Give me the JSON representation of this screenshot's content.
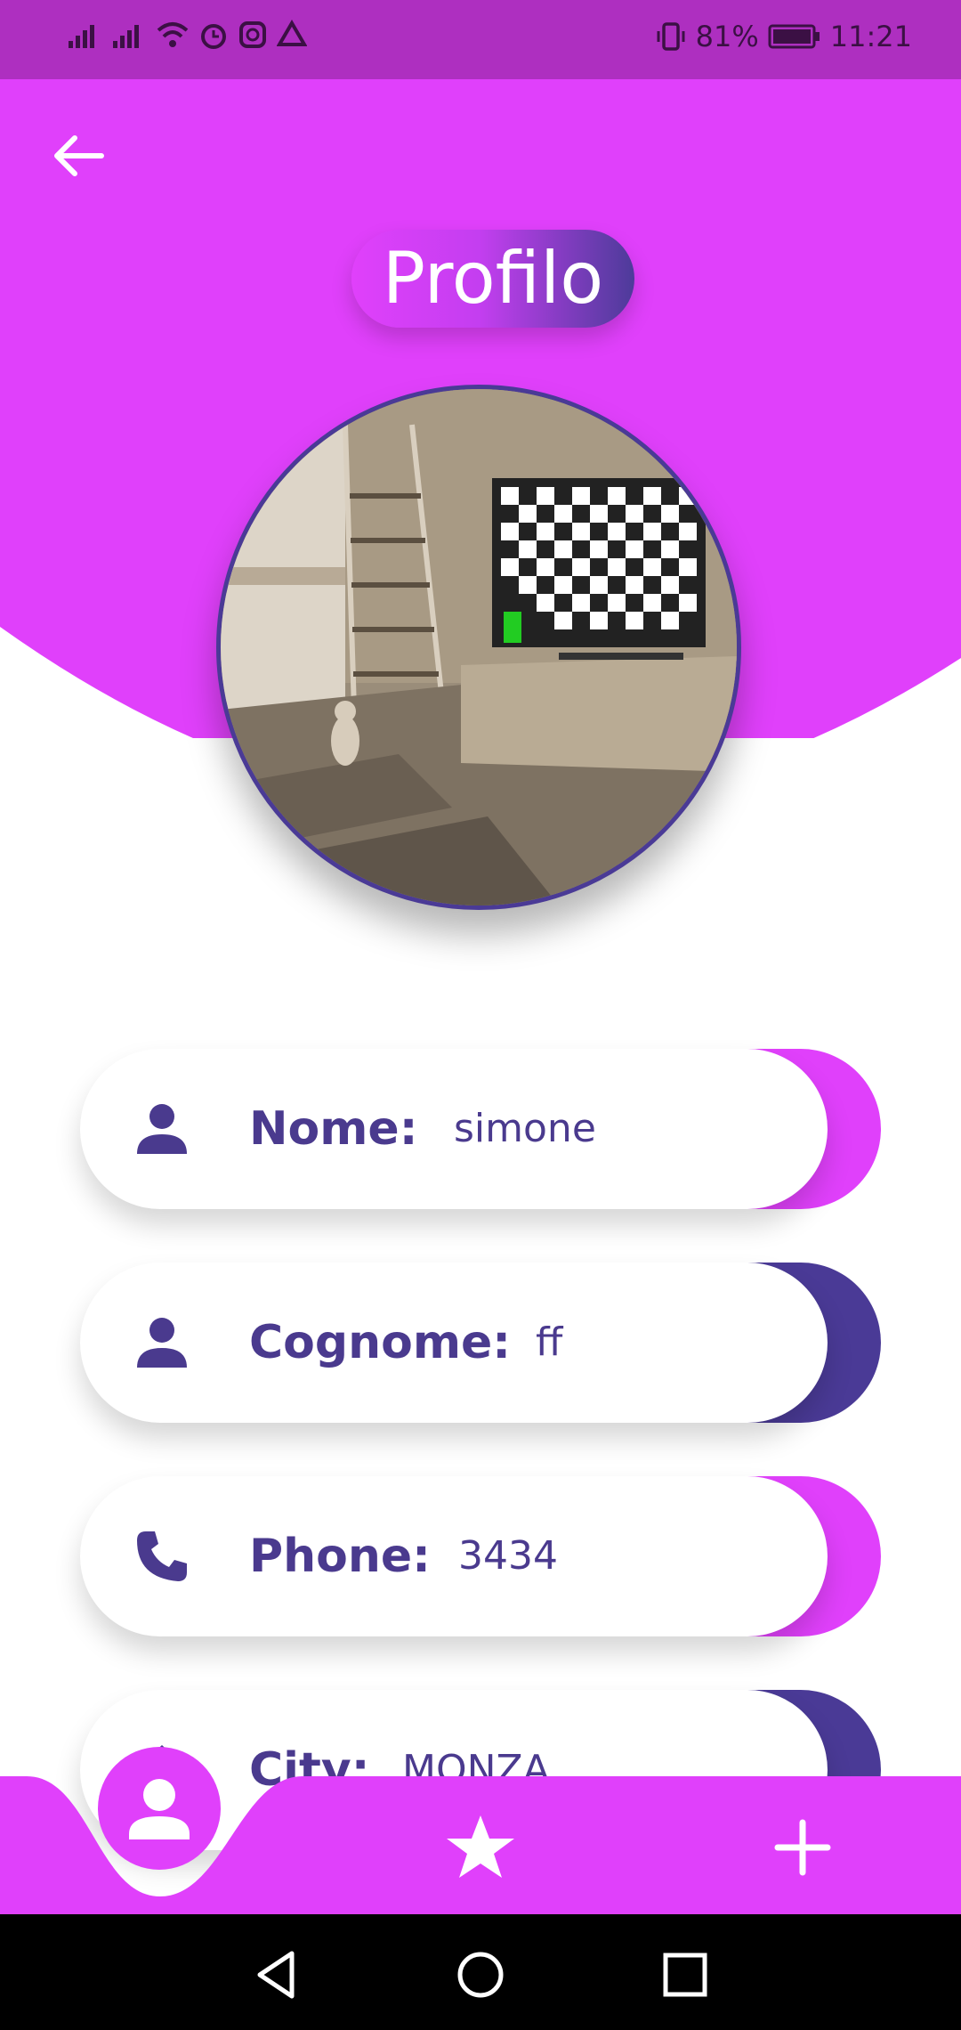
{
  "status_bar": {
    "battery": "81%",
    "time": "11:21"
  },
  "header": {
    "title": "Profilo"
  },
  "colors": {
    "magenta": "#e040fb",
    "indigo": "#4a3a96",
    "status": "#ae2fc0"
  },
  "fields": [
    {
      "label": "Nome:",
      "value": "simone",
      "icon": "person-icon",
      "accent": "magenta"
    },
    {
      "label": "Cognome:",
      "value": "ff",
      "icon": "person-icon",
      "accent": "indigo"
    },
    {
      "label": "Phone:",
      "value": "3434",
      "icon": "phone-icon",
      "accent": "magenta"
    },
    {
      "label": "City:",
      "value": "MONZA",
      "icon": "home-icon",
      "accent": "indigo"
    }
  ],
  "bottom_nav": {
    "items": [
      "profile-icon",
      "star-icon",
      "plus-icon"
    ]
  }
}
